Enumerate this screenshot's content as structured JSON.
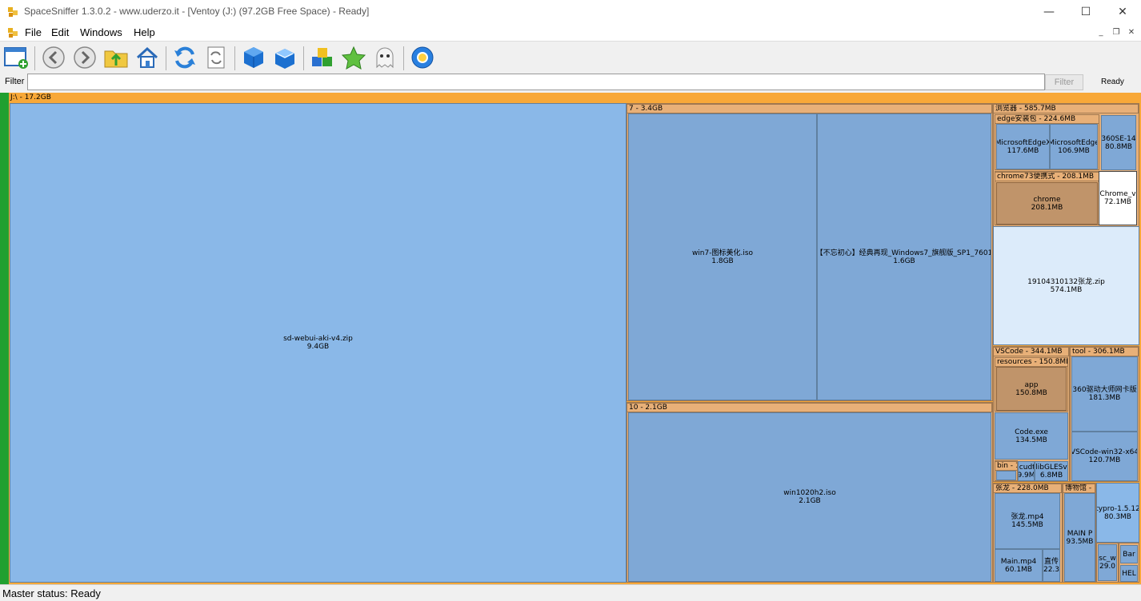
{
  "window": {
    "title": "SpaceSniffer 1.3.0.2 - www.uderzo.it - [Ventoy (J:) (97.2GB Free Space) - Ready]",
    "minimize": "—",
    "maximize": "☐",
    "close": "✕"
  },
  "menu": {
    "file": "File",
    "edit": "Edit",
    "windows": "Windows",
    "help": "Help"
  },
  "mdi": {
    "minimize": "_",
    "restore": "❐",
    "close": "✕"
  },
  "toolbar": {
    "icons": [
      "new-view-icon",
      "back-icon",
      "forward-icon",
      "up-folder-icon",
      "home-icon",
      "refresh-icon",
      "refresh-all-icon",
      "blue-cube-icon",
      "blue-cube-open-icon",
      "cubes-icon",
      "star-icon",
      "ghost-icon",
      "settings-icon"
    ]
  },
  "filter": {
    "label": "Filter",
    "value": "",
    "button": "Filter",
    "state": "Ready"
  },
  "treemap": {
    "root_header": "J:\\ - 17.2GB",
    "sd_name": "sd-webui-aki-v4.zip",
    "sd_size": "9.4GB",
    "folder7_header": "7 - 3.4GB",
    "win7_name": "win7-图标美化.iso",
    "win7_size": "1.8GB",
    "buchu_name": "【不忘初心】经典再现_Windows7_旗舰版_SP1_7601",
    "buchu_size": "1.6GB",
    "folder10_header": "10 - 2.1GB",
    "win10_name": "win1020h2.iso",
    "win10_size": "2.1GB",
    "browser_header": "浏览器 - 585.7MB",
    "edge_header": "edge安装包 - 224.6MB",
    "edgex_name": "MicrosoftEdgeX",
    "edgex_size": "117.6MB",
    "edge2_name": "MicrosoftEdge",
    "edge2_size": "106.9MB",
    "se360_name": "360SE-14",
    "se360_size": "80.8MB",
    "chrome73_header": "chrome73便携式 - 208.1MB",
    "chrome_name": "chrome",
    "chrome_size": "208.1MB",
    "chromev_name": "Chrome_v",
    "chromev_size": "72.1MB",
    "zip_name": "19104310132张龙.zip",
    "zip_size": "574.1MB",
    "vscode_header": "VSCode - 344.1MB",
    "resources_header": "resources - 150.8MB",
    "app_name": "app",
    "app_size": "150.8MB",
    "code_name": "Code.exe",
    "code_size": "134.5MB",
    "bin_header": "bin - 1",
    "icudt_name": "icudt",
    "icudt_size": "9.9M",
    "libgles_name": "libGLESv",
    "libgles_size": "6.8MB",
    "tool_header": "tool - 306.1MB",
    "driver_name": "360驱动大师网卡版",
    "driver_size": "181.3MB",
    "vscwin_name": "VSCode-win32-x64",
    "vscwin_size": "120.7MB",
    "zhang_header": "张龙 - 228.0MB",
    "zmp4_name": "张龙.mp4",
    "zmp4_size": "145.5MB",
    "main_name": "Main.mp4",
    "main_size": "60.1MB",
    "zhi_name": "直传",
    "zhi_size": "22.3",
    "bowu_header": "博物馆 - 1",
    "mainp_name": "MAIN P",
    "mainp_size": "93.5MB",
    "typro_name": "typro-1.5.12",
    "typro_size": "80.3MB",
    "sc_name": "sc_w",
    "sc_size": "29.0",
    "bar_name": "Bar",
    "help_name": "HEL"
  },
  "status": {
    "text": "Master status: Ready"
  }
}
